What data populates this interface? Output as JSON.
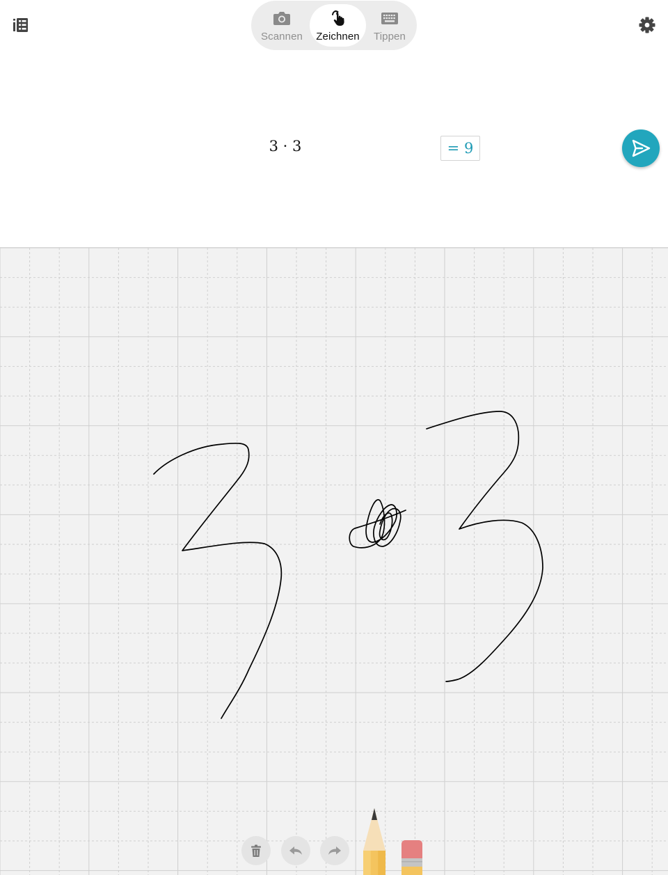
{
  "header": {
    "history_icon": "list-history-icon",
    "settings_icon": "gear-icon",
    "modes": [
      {
        "label": "Scannen",
        "icon": "camera-icon",
        "active": false
      },
      {
        "label": "Zeichnen",
        "icon": "hand-pointer-icon",
        "active": true
      },
      {
        "label": "Tippen",
        "icon": "keyboard-icon",
        "active": false
      }
    ]
  },
  "result": {
    "expression": "3 · 3",
    "solution": "= 9",
    "send_icon": "paper-plane-icon"
  },
  "colors": {
    "accent": "#22a6bd",
    "result_text": "#1f9bb5",
    "canvas_bg": "#f2f2f2",
    "ink": "#000000",
    "active_tab_text": "#111111",
    "inactive_tab_text": "#8f8f8f"
  },
  "canvas": {
    "handwritten_content": "3 · 3"
  },
  "toolbar": {
    "delete_icon": "trash-icon",
    "undo_icon": "undo-icon",
    "redo_icon": "redo-icon",
    "pen_tool": "pencil-icon",
    "eraser_tool": "eraser-icon",
    "selected_tool": "pencil"
  }
}
